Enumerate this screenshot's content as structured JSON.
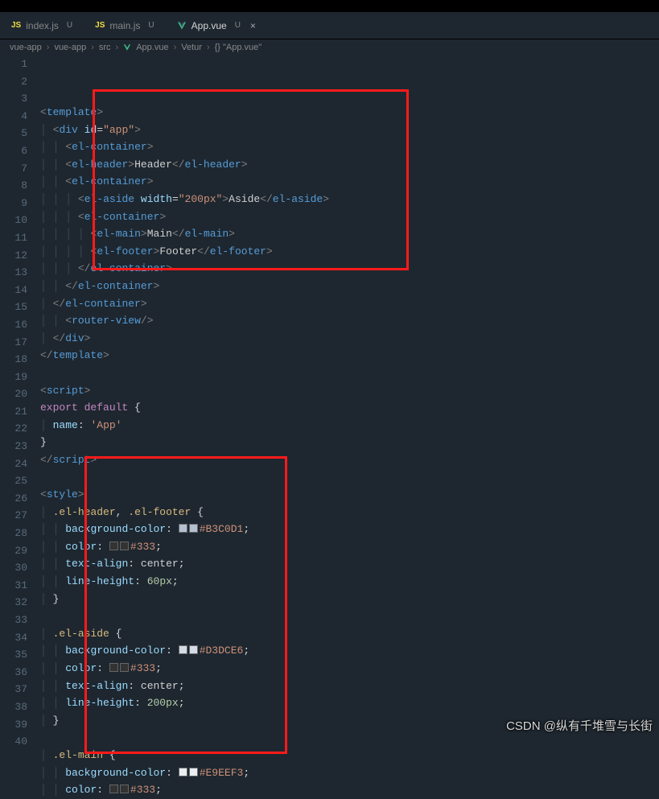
{
  "tabs": [
    {
      "icon": "js",
      "label": "index.js",
      "modified": "U",
      "active": false
    },
    {
      "icon": "js",
      "label": "main.js",
      "modified": "U",
      "active": false
    },
    {
      "icon": "vue",
      "label": "App.vue",
      "modified": "U",
      "active": true,
      "closable": true
    }
  ],
  "breadcrumb": [
    "vue-app",
    "vue-app",
    "src",
    "App.vue",
    "Vetur",
    "{} \"App.vue\""
  ],
  "lines_total": 40,
  "code": {
    "l1": {
      "indent": 0,
      "html": "<span class='tag-br'>&lt;</span><span class='tag-name'>template</span><span class='tag-br'>&gt;</span>"
    },
    "l2": {
      "indent": 1,
      "html": "<span class='tag-br'>&lt;</span><span class='tag-name'>div</span> <span class='attr-name'>id</span>=<span class='string'>\"app\"</span><span class='tag-br'>&gt;</span>"
    },
    "l3": {
      "indent": 2,
      "html": "<span class='tag-br'>&lt;</span><span class='tag-name'>el-container</span><span class='tag-br'>&gt;</span>"
    },
    "l4": {
      "indent": 2,
      "html": "<span class='tag-br'>&lt;</span><span class='tag-name'>el-header</span><span class='tag-br'>&gt;</span><span class='text'>Header</span><span class='tag-br'>&lt;/</span><span class='tag-name'>el-header</span><span class='tag-br'>&gt;</span>"
    },
    "l5": {
      "indent": 2,
      "html": "<span class='tag-br'>&lt;</span><span class='tag-name'>el-container</span><span class='tag-br'>&gt;</span>"
    },
    "l6": {
      "indent": 3,
      "html": "<span class='tag-br'>&lt;</span><span class='tag-name'>el-aside</span> <span class='attr-name'>width</span>=<span class='string'>\"200px\"</span><span class='tag-br'>&gt;</span><span class='text'>Aside</span><span class='tag-br'>&lt;/</span><span class='tag-name'>el-aside</span><span class='tag-br'>&gt;</span>"
    },
    "l7": {
      "indent": 3,
      "html": "<span class='tag-br'>&lt;</span><span class='tag-name'>el-container</span><span class='tag-br'>&gt;</span>"
    },
    "l8": {
      "indent": 4,
      "html": "<span class='tag-br'>&lt;</span><span class='tag-name'>el-main</span><span class='tag-br'>&gt;</span><span class='text'>Main</span><span class='tag-br'>&lt;/</span><span class='tag-name'>el-main</span><span class='tag-br'>&gt;</span>"
    },
    "l9": {
      "indent": 4,
      "html": "<span class='tag-br'>&lt;</span><span class='tag-name'>el-footer</span><span class='tag-br'>&gt;</span><span class='text'>Footer</span><span class='tag-br'>&lt;/</span><span class='tag-name'>el-footer</span><span class='tag-br'>&gt;</span>"
    },
    "l10": {
      "indent": 3,
      "html": "<span class='tag-br'>&lt;/</span><span class='tag-name'>el-container</span><span class='tag-br'>&gt;</span>"
    },
    "l11": {
      "indent": 2,
      "html": "<span class='tag-br'>&lt;/</span><span class='tag-name'>el-container</span><span class='tag-br'>&gt;</span>"
    },
    "l12": {
      "indent": 1,
      "html": "<span class='tag-br'>&lt;/</span><span class='tag-name'>el-container</span><span class='tag-br'>&gt;</span>"
    },
    "l13": {
      "indent": 2,
      "html": "<span class='tag-br'>&lt;</span><span class='tag-name'>router-view</span><span class='tag-br'>/&gt;</span>"
    },
    "l14": {
      "indent": 1,
      "html": "<span class='tag-br'>&lt;/</span><span class='tag-name'>div</span><span class='tag-br'>&gt;</span>"
    },
    "l15": {
      "indent": 0,
      "html": "<span class='tag-br'>&lt;/</span><span class='tag-name'>template</span><span class='tag-br'>&gt;</span>"
    },
    "l16": {
      "indent": 0,
      "html": ""
    },
    "l17": {
      "indent": 0,
      "html": "<span class='tag-br'>&lt;</span><span class='tag-name'>script</span><span class='tag-br'>&gt;</span>"
    },
    "l18": {
      "indent": 0,
      "html": "<span class='keyword'>export</span> <span class='keyword'>default</span> <span class='punct'>{</span>"
    },
    "l19": {
      "indent": 1,
      "html": "<span class='prop'>name</span><span class='punct'>:</span> <span class='string'>'App'</span>"
    },
    "l20": {
      "indent": 0,
      "html": "<span class='punct'>}</span>"
    },
    "l21": {
      "indent": 0,
      "html": "<span class='tag-br'>&lt;/</span><span class='tag-name'>script</span><span class='tag-br'>&gt;</span>"
    },
    "l22": {
      "indent": 0,
      "html": ""
    },
    "l23": {
      "indent": 0,
      "html": "<span class='tag-br'>&lt;</span><span class='tag-name'>style</span><span class='tag-br'>&gt;</span>"
    },
    "l24": {
      "indent": 1,
      "html": "<span class='sel'>.el-header</span><span class='punct'>,</span> <span class='sel'>.el-footer</span> <span class='punct'>{</span>"
    },
    "l25": {
      "indent": 2,
      "html": "<span class='prop'>background-color</span><span class='punct'>:</span> <span class='swatch' style='background:#B3C0D1'></span><span class='swatch' style='background:#B3C0D1'></span><span class='hex'>#B3C0D1</span><span class='punct'>;</span>"
    },
    "l26": {
      "indent": 2,
      "html": "<span class='prop'>color</span><span class='punct'>:</span> <span class='swatch' style='background:#333'></span><span class='swatch' style='background:#333'></span><span class='hex'>#333</span><span class='punct'>;</span>"
    },
    "l27": {
      "indent": 2,
      "html": "<span class='prop'>text-align</span><span class='punct'>:</span> <span class='text'>center</span><span class='punct'>;</span>"
    },
    "l28": {
      "indent": 2,
      "html": "<span class='prop'>line-height</span><span class='punct'>:</span> <span class='num'>60</span><span class='unit'>px</span><span class='punct'>;</span>"
    },
    "l29": {
      "indent": 1,
      "html": "<span class='punct'>}</span>"
    },
    "l30": {
      "indent": 0,
      "html": ""
    },
    "l31": {
      "indent": 1,
      "html": "<span class='sel'>.el-aside</span> <span class='punct'>{</span>"
    },
    "l32": {
      "indent": 2,
      "html": "<span class='prop'>background-color</span><span class='punct'>:</span> <span class='swatch' style='background:#D3DCE6'></span><span class='swatch' style='background:#D3DCE6'></span><span class='hex'>#D3DCE6</span><span class='punct'>;</span>"
    },
    "l33": {
      "indent": 2,
      "html": "<span class='prop'>color</span><span class='punct'>:</span> <span class='swatch' style='background:#333'></span><span class='swatch' style='background:#333'></span><span class='hex'>#333</span><span class='punct'>;</span>"
    },
    "l34": {
      "indent": 2,
      "html": "<span class='prop'>text-align</span><span class='punct'>:</span> <span class='text'>center</span><span class='punct'>;</span>"
    },
    "l35": {
      "indent": 2,
      "html": "<span class='prop'>line-height</span><span class='punct'>:</span> <span class='num'>200</span><span class='unit'>px</span><span class='punct'>;</span>"
    },
    "l36": {
      "indent": 1,
      "html": "<span class='punct'>}</span>"
    },
    "l37": {
      "indent": 0,
      "html": ""
    },
    "l38": {
      "indent": 1,
      "html": "<span class='sel'>.el-main</span> <span class='punct'>{</span>"
    },
    "l39": {
      "indent": 2,
      "html": "<span class='prop'>background-color</span><span class='punct'>:</span> <span class='swatch' style='background:#E9EEF3'></span><span class='swatch' style='background:#E9EEF3'></span><span class='hex'>#E9EEF3</span><span class='punct'>;</span>"
    },
    "l40": {
      "indent": 2,
      "html": "<span class='prop'>color</span><span class='punct'>:</span> <span class='swatch' style='background:#333'></span><span class='swatch' style='background:#333'></span><span class='hex'>#333</span><span class='punct'>;</span>"
    }
  },
  "watermark": "CSDN @纵有千堆雪与长街"
}
